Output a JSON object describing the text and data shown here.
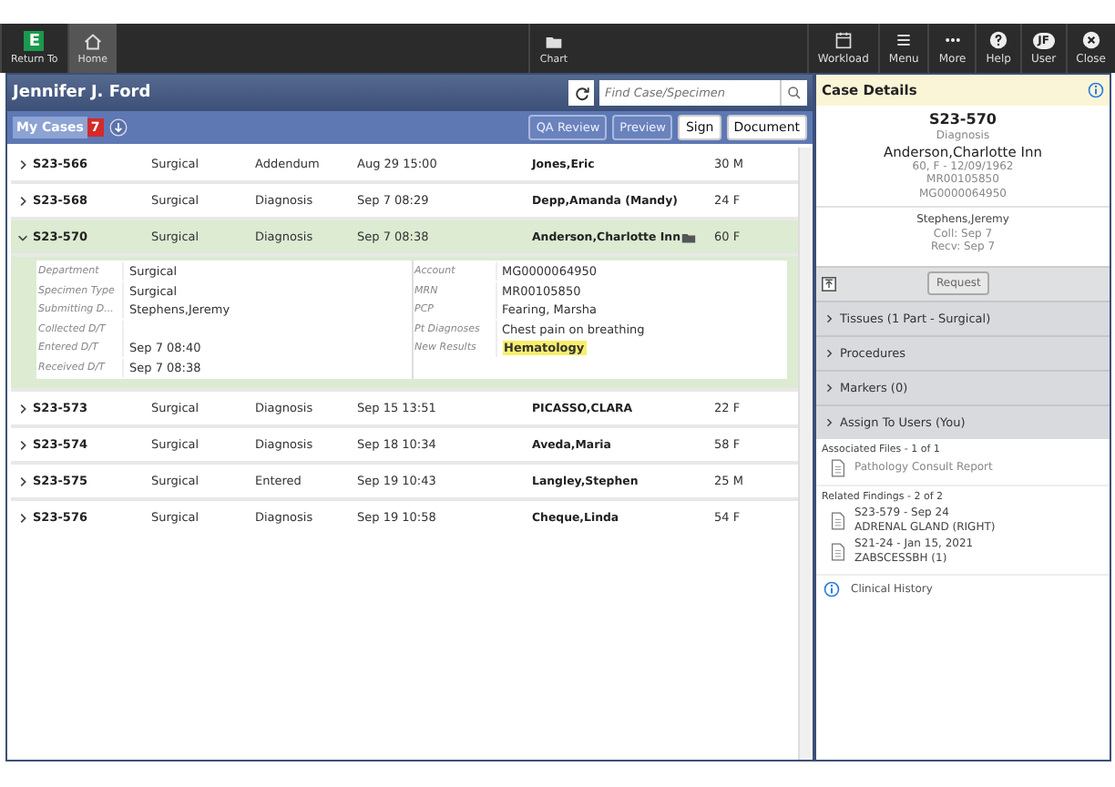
{
  "toolbar": {
    "left": [
      {
        "label": "Return To",
        "kind": "logo",
        "logo_text": "E",
        "selected": false
      },
      {
        "label": "Home",
        "kind": "home",
        "selected": true
      }
    ],
    "center": [
      {
        "label": "Chart",
        "kind": "folder",
        "selected": false
      }
    ],
    "right": [
      {
        "label": "Workload",
        "kind": "calendar"
      },
      {
        "label": "Menu",
        "kind": "list"
      },
      {
        "label": "More",
        "kind": "dots"
      },
      {
        "label": "Help",
        "kind": "help"
      },
      {
        "label": "User",
        "kind": "avatar",
        "initials": "JF"
      },
      {
        "label": "Close",
        "kind": "close"
      }
    ]
  },
  "header": {
    "user_name": "Jennifer J. Ford",
    "search": {
      "placeholder": "Find Case/Specimen"
    }
  },
  "tabs": [
    {
      "label": "My Cases",
      "count": "7",
      "selected": true
    }
  ],
  "actions": [
    {
      "label": "QA Review",
      "kind": "outline"
    },
    {
      "label": "Preview",
      "kind": "outline"
    },
    {
      "label": "Sign",
      "kind": "solid"
    },
    {
      "label": "Document",
      "kind": "solid"
    }
  ],
  "cases": [
    {
      "id": "S23-566",
      "type": "Surgical",
      "status": "Addendum",
      "date": "Aug 29 15:00",
      "patient": "Jones,Eric",
      "age_sex": "30 M",
      "expanded": false,
      "selected": false,
      "has_note": false
    },
    {
      "id": "S23-568",
      "type": "Surgical",
      "status": "Diagnosis",
      "date": "Sep 7 08:29",
      "patient": "Depp,Amanda (Mandy)",
      "age_sex": "24 F",
      "expanded": false,
      "selected": false,
      "has_note": false
    },
    {
      "id": "S23-570",
      "type": "Surgical",
      "status": "Diagnosis",
      "date": "Sep 7 08:38",
      "patient": "Anderson,Charlotte Inn",
      "age_sex": "60 F",
      "expanded": true,
      "selected": true,
      "has_note": true,
      "details_left": [
        {
          "label": "Department",
          "value": "Surgical",
          "highlight": false
        },
        {
          "label": "Specimen Type",
          "value": "Surgical",
          "highlight": false
        },
        {
          "label": "Submitting D...",
          "value": "Stephens,Jeremy",
          "highlight": false
        },
        {
          "label": "Collected D/T",
          "highlight": false
        },
        {
          "label": "Entered D/T",
          "value": "Sep 7 08:40",
          "highlight": false
        },
        {
          "label": "Received D/T",
          "value": "Sep 7 08:38",
          "highlight": false
        }
      ],
      "details_right": [
        {
          "label": "Account",
          "value": "MG0000064950",
          "highlight": false
        },
        {
          "label": "MRN",
          "value": "MR00105850",
          "highlight": false
        },
        {
          "label": "PCP",
          "value": "Fearing, Marsha",
          "highlight": false
        },
        {
          "label": "Pt Diagnoses",
          "value": "Chest pain on breathing",
          "highlight": false
        },
        {
          "label": "New Results",
          "value": "Hematology",
          "highlight": true
        }
      ]
    },
    {
      "id": "S23-573",
      "type": "Surgical",
      "status": "Diagnosis",
      "date": "Sep 15 13:51",
      "patient": "PICASSO,CLARA",
      "age_sex": "22 F",
      "expanded": false,
      "selected": false,
      "has_note": false
    },
    {
      "id": "S23-574",
      "type": "Surgical",
      "status": "Diagnosis",
      "date": "Sep 18 10:34",
      "patient": "Aveda,Maria",
      "age_sex": "58 F",
      "expanded": false,
      "selected": false,
      "has_note": false
    },
    {
      "id": "S23-575",
      "type": "Surgical",
      "status": "Entered",
      "date": "Sep 19 10:43",
      "patient": "Langley,Stephen",
      "age_sex": "25 M",
      "expanded": false,
      "selected": false,
      "has_note": false
    },
    {
      "id": "S23-576",
      "type": "Surgical",
      "status": "Diagnosis",
      "date": "Sep 19 10:58",
      "patient": "Cheque,Linda",
      "age_sex": "54 F",
      "expanded": false,
      "selected": false,
      "has_note": false
    }
  ],
  "case_details": {
    "title": "Case Details",
    "case_id": "S23-570",
    "status": "Diagnosis",
    "patient": "Anderson,Charlotte Inn",
    "info_lines": [
      "60, F - 12/09/1962",
      "MR00105850",
      "MG0000064950"
    ],
    "staff_lines": [
      "Stephens,Jeremy",
      "Coll: Sep 7",
      "Recv: Sep 7"
    ],
    "request_button": "Request",
    "sections": [
      {
        "label": "Tissues (1 Part - Surgical)",
        "expanded": false
      },
      {
        "label": "Procedures",
        "expanded": false
      },
      {
        "label": "Markers (0)",
        "expanded": false
      },
      {
        "label": "Assign To Users (You)",
        "expanded": false
      }
    ],
    "associated_files": {
      "heading": "Associated Files - 1 of 1",
      "items": [
        {
          "lines": [
            "Pathology Consult Report"
          ]
        }
      ]
    },
    "related_findings": {
      "heading": "Related Findings - 2 of 2",
      "items": [
        {
          "lines": [
            "S23-579 - Sep 24",
            "ADRENAL GLAND (RIGHT)"
          ]
        },
        {
          "lines": [
            "S21-24 - Jan 15, 2021",
            "ZABSCESSBH (1)"
          ]
        }
      ]
    },
    "clinical_history": "Clinical History"
  }
}
